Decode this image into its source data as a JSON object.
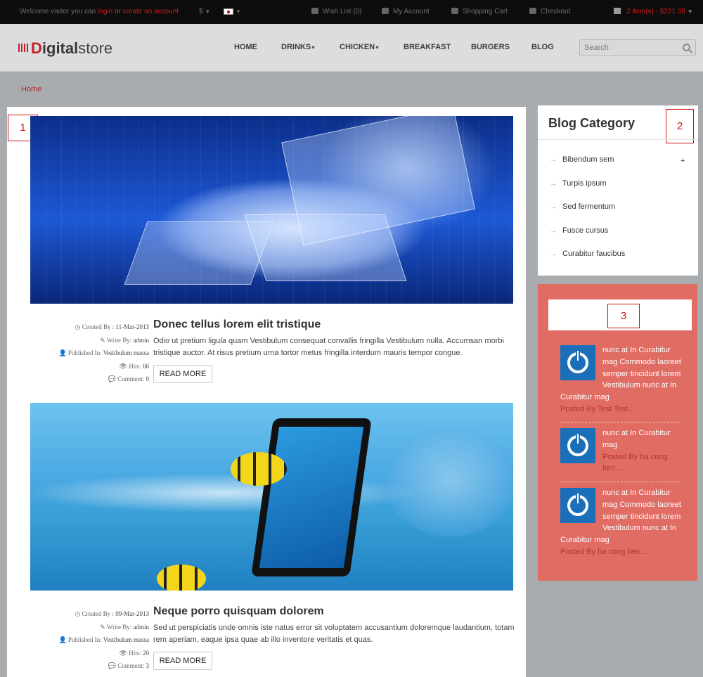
{
  "topbar": {
    "welcome_text": "Welcome visitor you can ",
    "login_label": "login",
    "or_text": " or ",
    "create_account_label": "create an account",
    "currency_symbol": "$",
    "wishlist_label": "Wish List (0)",
    "my_account_label": "My Account",
    "shopping_cart_label": "Shopping Cart",
    "checkout_label": "Checkout",
    "cart_summary": "2 item(s) - $221.38"
  },
  "header": {
    "logo_initial": "D",
    "logo_bold": "igital",
    "logo_rest": "store",
    "nav": [
      "HOME",
      "DRINKS",
      "CHICKEN",
      "BREAKFAST",
      "BURGERS",
      "BLOG"
    ],
    "search_placeholder": "Search"
  },
  "breadcrumb": {
    "home_label": "Home"
  },
  "callouts": [
    "1",
    "2",
    "3"
  ],
  "posts": [
    {
      "created_label": "Created By : ",
      "created_date": "11-Mar-2013",
      "write_label": "Write By: ",
      "author": "admin",
      "published_label": "Published In: ",
      "category": "Vestibulum massa",
      "hits_label": "Hits: ",
      "hits": "66",
      "comment_label": "Comment: ",
      "comments": "0",
      "title": "Donec tellus lorem elit tristique",
      "excerpt": "Odio ut pretium ligula quam Vestibulum consequat convallis fringilla Vestibulum nulla. Accumsan morbi tristique auctor. At risus pretium urna tortor metus fringilla interdum mauris tempor congue.",
      "read_more": "READ MORE"
    },
    {
      "created_label": "Created By : ",
      "created_date": "09-Mar-2013",
      "write_label": "Write By: ",
      "author": "admin",
      "published_label": "Published In: ",
      "category": "Vestibulum massa",
      "hits_label": "Hits: ",
      "hits": "20",
      "comment_label": "Comment: ",
      "comments": "3",
      "title": "Neque porro quisquam dolorem",
      "excerpt": "Sed ut perspiciatis unde omnis iste natus error sit voluptatem accusantium doloremque laudantium, totam rem aperiam, eaque ipsa quae ab illo inventore veritatis et quas.",
      "read_more": "READ MORE"
    }
  ],
  "blog_category": {
    "title": "Blog Category",
    "items": [
      "Bibendum sem",
      "Turpis ipsum",
      "Sed fermentum",
      "Fusce cursus",
      "Curabitur faucibus"
    ],
    "expand_symbol": "+"
  },
  "latest_posts": [
    {
      "text": "nunc at In Curabitur mag Commodo laoreet semper tincidunt lorem Vestibulum nunc at In Curabitur mag",
      "byline": "Posted By Test Test...."
    },
    {
      "text": "nunc at In Curabitur mag",
      "byline": "Posted By ha cong tien..."
    },
    {
      "text": "nunc at In Curabitur mag Commodo laoreet semper tincidunt lorem Vestibulum nunc at In Curabitur mag",
      "byline": "Posted By ha cong tien..."
    }
  ],
  "colors": {
    "accent_red": "#c0222a",
    "latest_panel_bg": "#e06c64",
    "thumb_blue": "#1b6fb8"
  }
}
